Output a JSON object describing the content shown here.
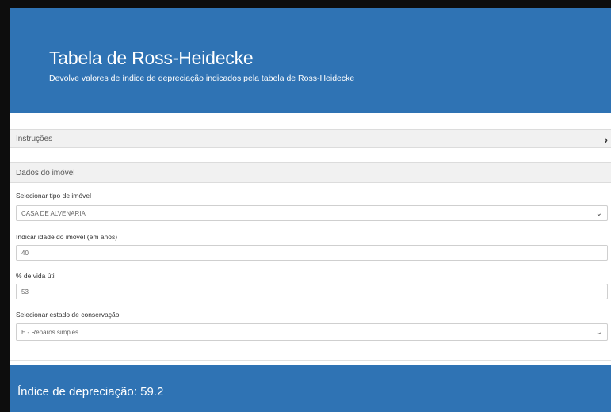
{
  "header": {
    "title": "Tabela de Ross-Heidecke",
    "subtitle": "Devolve valores de índice de depreciação indicados pela tabela de Ross-Heidecke"
  },
  "instructions": {
    "label": "Instruções",
    "chevron": "›"
  },
  "property": {
    "section_label": "Dados do imóvel",
    "type": {
      "label": "Selecionar tipo de imóvel",
      "value": "CASA DE ALVENARIA",
      "icon": "chevron-down-icon"
    },
    "age": {
      "label": "Indicar idade do imóvel (em anos)",
      "value": "40"
    },
    "useful_life": {
      "label": "% de vida útil",
      "value": "53"
    },
    "conservation": {
      "label": "Selecionar estado de conservação",
      "value": "E - Reparos simples",
      "icon": "chevron-down-icon"
    }
  },
  "result": {
    "label": "Índice de depreciação:",
    "value": "59.2"
  },
  "colors": {
    "primary": "#2f73b4",
    "panel": "#f1f1f1"
  }
}
